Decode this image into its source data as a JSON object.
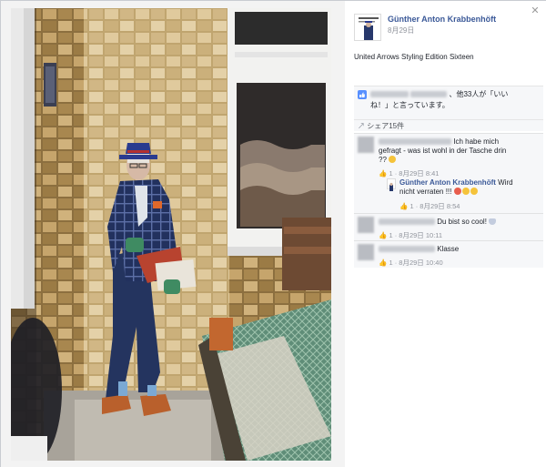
{
  "post": {
    "author": "Günther Anton Krabbenhöft",
    "date": "8月29日",
    "caption": "United Arrows Styling Edition Sixteen"
  },
  "likes": {
    "summary_tail": "、他33人が「いい",
    "summary_line2": "ね！」と言っています。",
    "share": "シェア15件"
  },
  "comments": [
    {
      "text_line1": "Ich habe mich",
      "text_line2": "gefragt - was ist wohl in der Tasche drin",
      "text_line3": "?? ",
      "likes": "1",
      "date": "8月29日 8:41"
    },
    {
      "author": "Günther Anton Krabbenhöft",
      "text_line1": "Wird",
      "text_line2": "nicht verraten !!! ",
      "likes": "1",
      "date": "8月29日 8:54"
    },
    {
      "text": "Du bist so cool! ",
      "likes": "1",
      "date": "8月29日 10:11"
    },
    {
      "text": "Klasse",
      "likes": "1",
      "date": "8月29日 10:40"
    }
  ],
  "icons": {
    "close": "close-icon",
    "like": "like-icon",
    "share": "share-icon",
    "thumb": "thumbs-up-icon"
  },
  "colors": {
    "link": "#3b5998",
    "meta": "#90949c",
    "panel": "#f6f7f9"
  }
}
